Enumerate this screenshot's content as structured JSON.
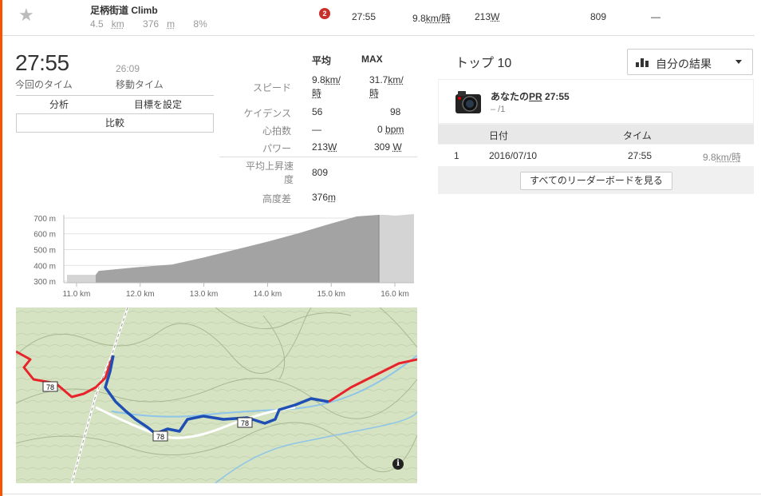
{
  "segment": {
    "name": "足柄街道 Climb",
    "distance": "4.5",
    "distance_unit": "km",
    "elev_gain": "376",
    "elev_unit": "m",
    "grade": "8%",
    "rank_badge": "2",
    "time": "27:55",
    "speed": "9.8",
    "speed_unit": "km/時",
    "power": "213",
    "power_unit": "W",
    "vam": "809",
    "hr": "—"
  },
  "effort": {
    "elapsed_time": "27:55",
    "elapsed_label": "今回のタイム",
    "moving_time": "26:09",
    "moving_label": "移動タイム"
  },
  "buttons": {
    "analysis": "分析",
    "set_goal": "目標を設定",
    "compare": "比較"
  },
  "stats": {
    "head_avg": "平均",
    "head_max": "MAX",
    "rows": [
      {
        "label": "スピード",
        "avg": "9.8",
        "avg_unit": "km/時",
        "max": "31.7",
        "max_unit": "km/時"
      },
      {
        "label": "ケイデンス",
        "avg": "56",
        "avg_unit": "",
        "max": "98",
        "max_unit": ""
      },
      {
        "label": "心拍数",
        "avg": "—",
        "avg_unit": "",
        "max": "0",
        "max_unit": "bpm"
      },
      {
        "label": "パワー",
        "avg": "213",
        "avg_unit": "W",
        "max": "309",
        "max_unit": "W"
      }
    ],
    "vam_label": "平均上昇速度",
    "vam_value": "809",
    "elev_label": "高度差",
    "elev_value": "376",
    "elev_unit": "m"
  },
  "chart_data": {
    "type": "area",
    "x_ticks": [
      "11.0 km",
      "12.0 km",
      "13.0 km",
      "14.0 km",
      "15.0 km",
      "16.0 km"
    ],
    "y_ticks": [
      "700 m",
      "600 m",
      "500 m",
      "400 m",
      "300 m"
    ],
    "x": [
      10.85,
      11.3,
      11.35,
      12.0,
      12.5,
      13.0,
      13.5,
      14.0,
      14.5,
      15.0,
      15.4,
      15.75,
      15.85,
      16.0,
      16.3
    ],
    "y": [
      340,
      340,
      365,
      390,
      405,
      450,
      500,
      550,
      605,
      665,
      710,
      720,
      720,
      715,
      725
    ],
    "xlim": [
      10.8,
      16.3
    ],
    "ylim": [
      290,
      720
    ],
    "highlight_range": [
      11.3,
      15.75
    ]
  },
  "map": {
    "road_label": "78",
    "info": "i"
  },
  "top10": {
    "title": "トップ 10",
    "filter_label": "自分の結果",
    "pr_title_prefix": "あなたの",
    "pr_title_pr": "PR",
    "pr_time": "27:55",
    "pr_sub": "– /1",
    "col_date": "日付",
    "col_time": "タイム",
    "rows": [
      {
        "rank": "1",
        "date": "2016/07/10",
        "time": "27:55",
        "speed": "9.8",
        "speed_unit": "km/時"
      }
    ],
    "view_all": "すべてのリーダーボードを見る"
  }
}
